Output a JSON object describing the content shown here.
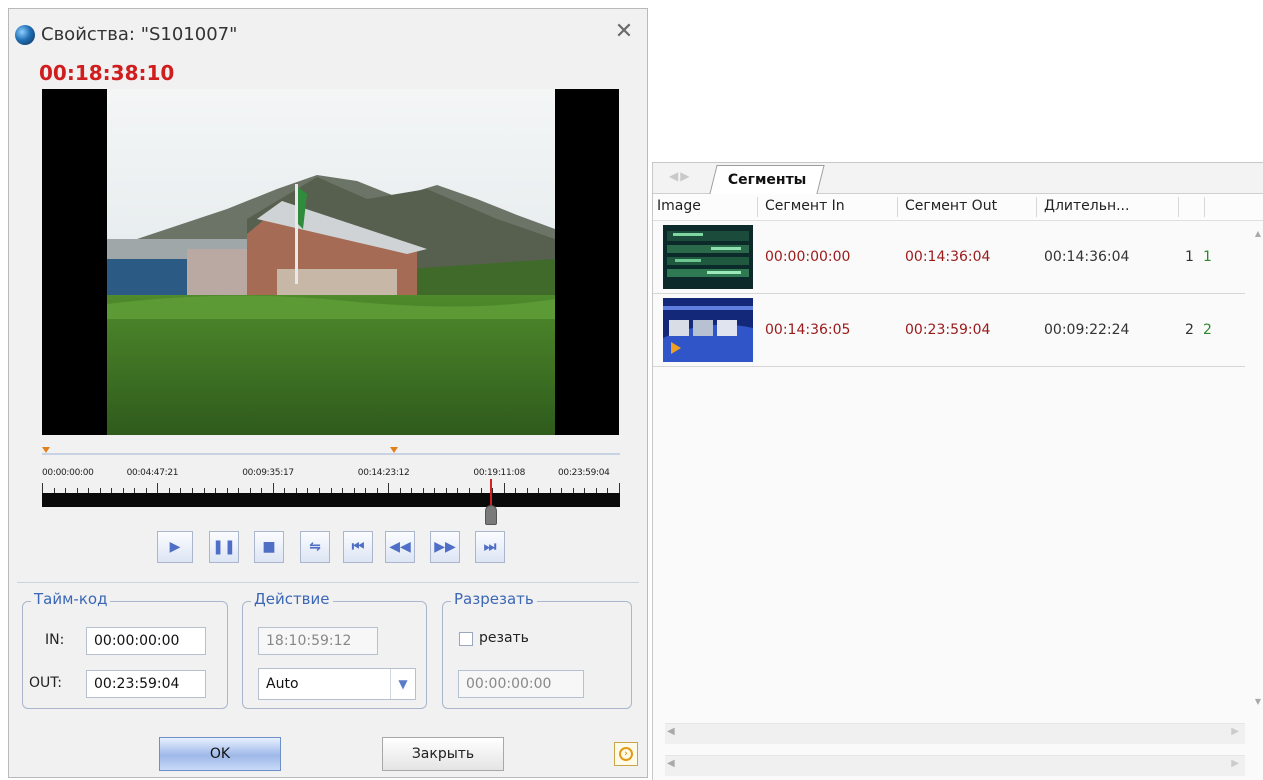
{
  "dialog": {
    "title": "Свойства: \"S101007\"",
    "current_timecode": "00:18:38:10",
    "timeline": {
      "labels": [
        "00:00:00:00",
        "00:04:47:21",
        "00:09:35:17",
        "00:14:23:12",
        "00:19:11:08",
        "00:23:59:04"
      ],
      "playhead_fraction": 0.777,
      "segment_marker_fractions": [
        0.0,
        0.609
      ]
    },
    "transport": [
      "play",
      "pause",
      "stop",
      "swap",
      "go-to-start",
      "rewind",
      "fast-forward",
      "go-to-end"
    ],
    "timecode_group": {
      "title": "Тайм-код",
      "in_label": "IN:",
      "in_value": "00:00:00:00",
      "out_label": "OUT:",
      "out_value": "00:23:59:04"
    },
    "action_group": {
      "title": "Действие",
      "time_value": "18:10:59:12",
      "mode": "Auto"
    },
    "cut_group": {
      "title": "Разрезать",
      "checkbox_label": "резать",
      "checked": false,
      "value": "00:00:00:00"
    },
    "ok_label": "OK",
    "close_label": "Закрыть"
  },
  "segments_panel": {
    "tab_label": "Сегменты",
    "columns": [
      "Image",
      "Сегмент In",
      "Сегмент Out",
      "Длительн..."
    ],
    "rows": [
      {
        "in": "00:00:00:00",
        "out": "00:14:36:04",
        "duration": "00:14:36:04",
        "n1": "1",
        "n2": "1"
      },
      {
        "in": "00:14:36:05",
        "out": "00:23:59:04",
        "duration": "00:09:22:24",
        "n1": "2",
        "n2": "2"
      }
    ]
  },
  "colors": {
    "timecode_red": "#d01d1d",
    "segment_tc_red": "#9a1a1a",
    "group_title_blue": "#3b67b5",
    "accent_orange": "#e2801e",
    "count_green": "#2c8a2c"
  }
}
